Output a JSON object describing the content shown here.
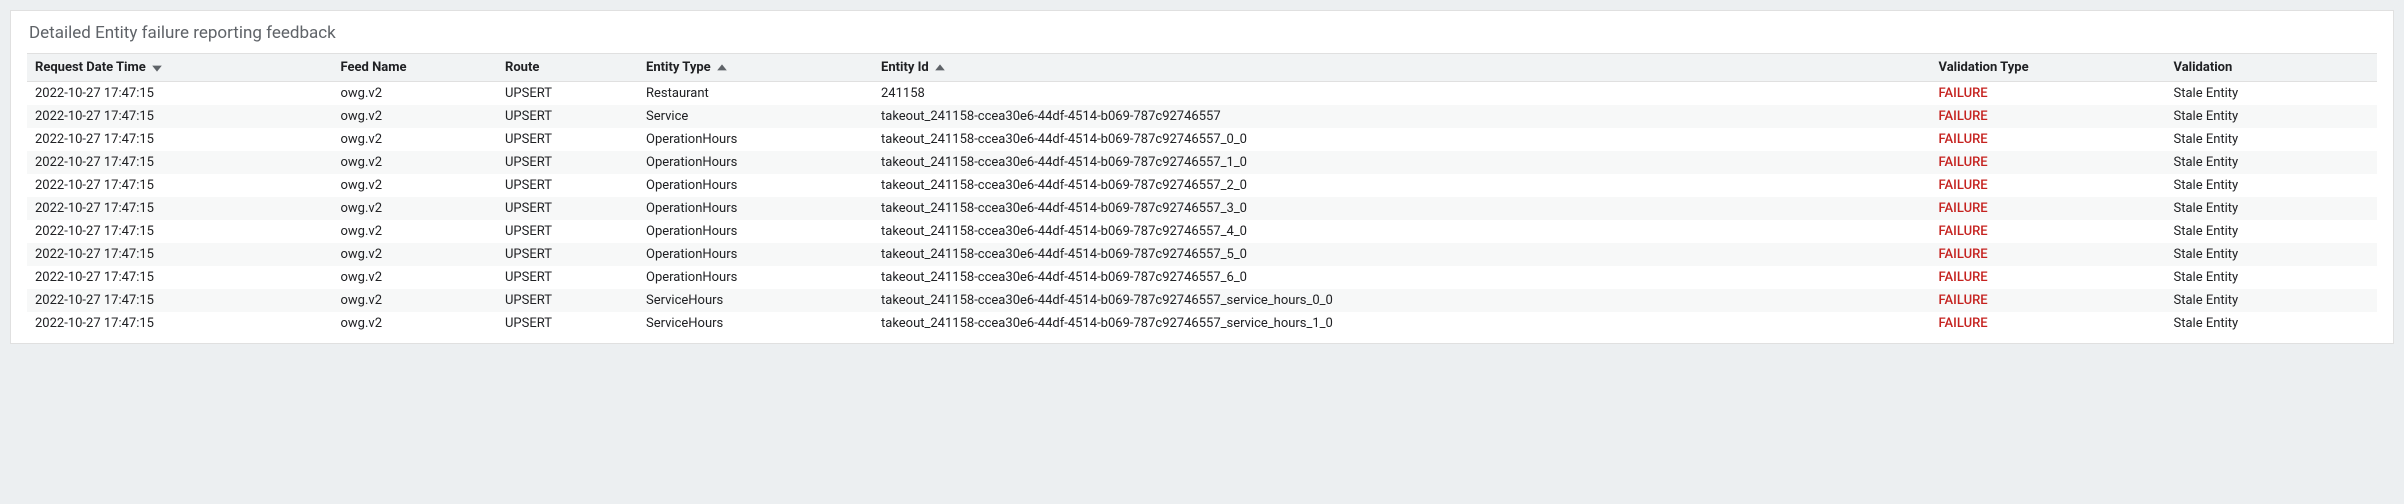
{
  "title": "Detailed Entity failure reporting feedback",
  "columns": {
    "request_date_time": "Request Date Time",
    "feed_name": "Feed Name",
    "route": "Route",
    "entity_type": "Entity Type",
    "entity_id": "Entity Id",
    "validation_type": "Validation Type",
    "validation": "Validation"
  },
  "sort": {
    "request_date_time": "desc",
    "entity_type": "asc",
    "entity_id": "asc"
  },
  "rows": [
    {
      "request_date_time": "2022-10-27 17:47:15",
      "feed_name": "owg.v2",
      "route": "UPSERT",
      "entity_type": "Restaurant",
      "entity_id": "241158",
      "validation_type": "FAILURE",
      "validation": "Stale Entity"
    },
    {
      "request_date_time": "2022-10-27 17:47:15",
      "feed_name": "owg.v2",
      "route": "UPSERT",
      "entity_type": "Service",
      "entity_id": "takeout_241158-ccea30e6-44df-4514-b069-787c92746557",
      "validation_type": "FAILURE",
      "validation": "Stale Entity"
    },
    {
      "request_date_time": "2022-10-27 17:47:15",
      "feed_name": "owg.v2",
      "route": "UPSERT",
      "entity_type": "OperationHours",
      "entity_id": "takeout_241158-ccea30e6-44df-4514-b069-787c92746557_0_0",
      "validation_type": "FAILURE",
      "validation": "Stale Entity"
    },
    {
      "request_date_time": "2022-10-27 17:47:15",
      "feed_name": "owg.v2",
      "route": "UPSERT",
      "entity_type": "OperationHours",
      "entity_id": "takeout_241158-ccea30e6-44df-4514-b069-787c92746557_1_0",
      "validation_type": "FAILURE",
      "validation": "Stale Entity"
    },
    {
      "request_date_time": "2022-10-27 17:47:15",
      "feed_name": "owg.v2",
      "route": "UPSERT",
      "entity_type": "OperationHours",
      "entity_id": "takeout_241158-ccea30e6-44df-4514-b069-787c92746557_2_0",
      "validation_type": "FAILURE",
      "validation": "Stale Entity"
    },
    {
      "request_date_time": "2022-10-27 17:47:15",
      "feed_name": "owg.v2",
      "route": "UPSERT",
      "entity_type": "OperationHours",
      "entity_id": "takeout_241158-ccea30e6-44df-4514-b069-787c92746557_3_0",
      "validation_type": "FAILURE",
      "validation": "Stale Entity"
    },
    {
      "request_date_time": "2022-10-27 17:47:15",
      "feed_name": "owg.v2",
      "route": "UPSERT",
      "entity_type": "OperationHours",
      "entity_id": "takeout_241158-ccea30e6-44df-4514-b069-787c92746557_4_0",
      "validation_type": "FAILURE",
      "validation": "Stale Entity"
    },
    {
      "request_date_time": "2022-10-27 17:47:15",
      "feed_name": "owg.v2",
      "route": "UPSERT",
      "entity_type": "OperationHours",
      "entity_id": "takeout_241158-ccea30e6-44df-4514-b069-787c92746557_5_0",
      "validation_type": "FAILURE",
      "validation": "Stale Entity"
    },
    {
      "request_date_time": "2022-10-27 17:47:15",
      "feed_name": "owg.v2",
      "route": "UPSERT",
      "entity_type": "OperationHours",
      "entity_id": "takeout_241158-ccea30e6-44df-4514-b069-787c92746557_6_0",
      "validation_type": "FAILURE",
      "validation": "Stale Entity"
    },
    {
      "request_date_time": "2022-10-27 17:47:15",
      "feed_name": "owg.v2",
      "route": "UPSERT",
      "entity_type": "ServiceHours",
      "entity_id": "takeout_241158-ccea30e6-44df-4514-b069-787c92746557_service_hours_0_0",
      "validation_type": "FAILURE",
      "validation": "Stale Entity"
    },
    {
      "request_date_time": "2022-10-27 17:47:15",
      "feed_name": "owg.v2",
      "route": "UPSERT",
      "entity_type": "ServiceHours",
      "entity_id": "takeout_241158-ccea30e6-44df-4514-b069-787c92746557_service_hours_1_0",
      "validation_type": "FAILURE",
      "validation": "Stale Entity"
    }
  ]
}
